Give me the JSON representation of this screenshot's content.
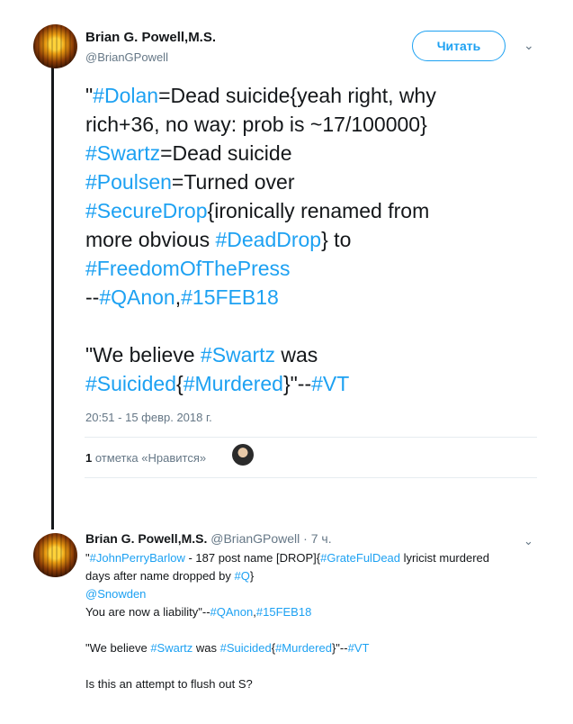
{
  "tweet": {
    "author_name": "Brian G. Powell,M.S.",
    "author_handle": "@BrianGPowell",
    "follow_label": "Читать",
    "chevron": "⌄",
    "text": {
      "l1a": "\"",
      "l1b": "#Dolan",
      "l1c": "=Dead suicide{yeah right, why",
      "l2": "rich+36, no way: prob is ~17/100000}",
      "l3a": "#Swartz",
      "l3b": "=Dead suicide",
      "l4a": "#Poulsen",
      "l4b": "=Turned over",
      "l5a": "#SecureDrop",
      "l5b": "{ironically renamed from",
      "l6a": "more obvious ",
      "l6b": "#DeadDrop",
      "l6c": "} to",
      "l7": "#FreedomOfThePress",
      "l8a": "--",
      "l8b": "#QAnon",
      "l8c": ",",
      "l8d": "#15FEB18",
      "l9a": "\"We believe ",
      "l9b": "#Swartz",
      "l9c": " was",
      "l10a": "#Suicided",
      "l10b": "{",
      "l10c": "#Murdered",
      "l10d": "}\"--",
      "l10e": "#VT"
    },
    "timestamp": "20:51 - 15 февр. 2018 г.",
    "likes_count": "1",
    "likes_label": "отметка «Нравится»"
  },
  "reply": {
    "author_name": "Brian G. Powell,M.S.",
    "author_handle": "@BrianGPowell",
    "time": "· 7 ч.",
    "chevron": "⌄",
    "text": {
      "r1a": "\"",
      "r1b": "#JohnPerryBarlow",
      "r1c": " - 187 post name [DROP]{",
      "r1d": "#GrateFulDead",
      "r1e": " lyricist murdered",
      "r2a": "days after name dropped by ",
      "r2b": "#Q",
      "r2c": "}",
      "r3": "@Snowden",
      "r4a": "You are now a liability\"--",
      "r4b": "#QAnon",
      "r4c": ",",
      "r4d": "#15FEB18",
      "r5a": "\"We believe ",
      "r5b": "#Swartz",
      "r5c": " was ",
      "r5d": "#Suicided",
      "r5e": "{",
      "r5f": "#Murdered",
      "r5g": "}\"--",
      "r5h": "#VT",
      "r6": "Is this an attempt to flush out S?"
    }
  },
  "colors": {
    "link": "#1da1f2",
    "text": "#14171a",
    "muted": "#657786"
  }
}
